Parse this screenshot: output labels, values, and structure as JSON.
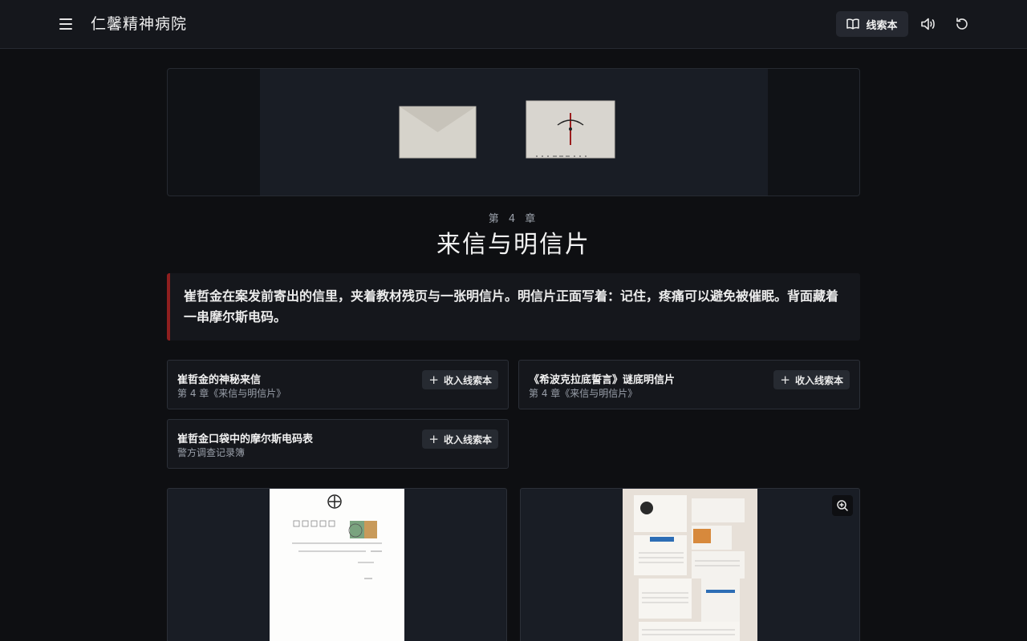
{
  "header": {
    "app_title": "仁馨精神病院",
    "clue_book_label": "线索本"
  },
  "chapter": {
    "number_label": "第 4 章",
    "title": "来信与明信片",
    "summary": "崔哲金在案发前寄出的信里，夹着教材残页与一张明信片。明信片正面写着：记住，疼痛可以避免被催眠。背面藏着一串摩尔斯电码。"
  },
  "clues": [
    {
      "title": "崔哲金的神秘来信",
      "source": "第 4 章《来信与明信片》",
      "button": "收入线索本"
    },
    {
      "title": "《希波克拉底誓言》谜底明信片",
      "source": "第 4 章《来信与明信片》",
      "button": "收入线索本"
    },
    {
      "title": "崔哲金口袋中的摩尔斯电码表",
      "source": "警方调查记录簿",
      "button": "收入线索本"
    }
  ],
  "icons": {
    "menu": "menu-icon",
    "book": "book-icon",
    "sound": "volume-icon",
    "restart": "restart-icon",
    "zoom": "zoom-in-icon"
  },
  "colors": {
    "accent": "#8f1f1f",
    "background": "#0e0f12",
    "surface": "#15171c"
  }
}
